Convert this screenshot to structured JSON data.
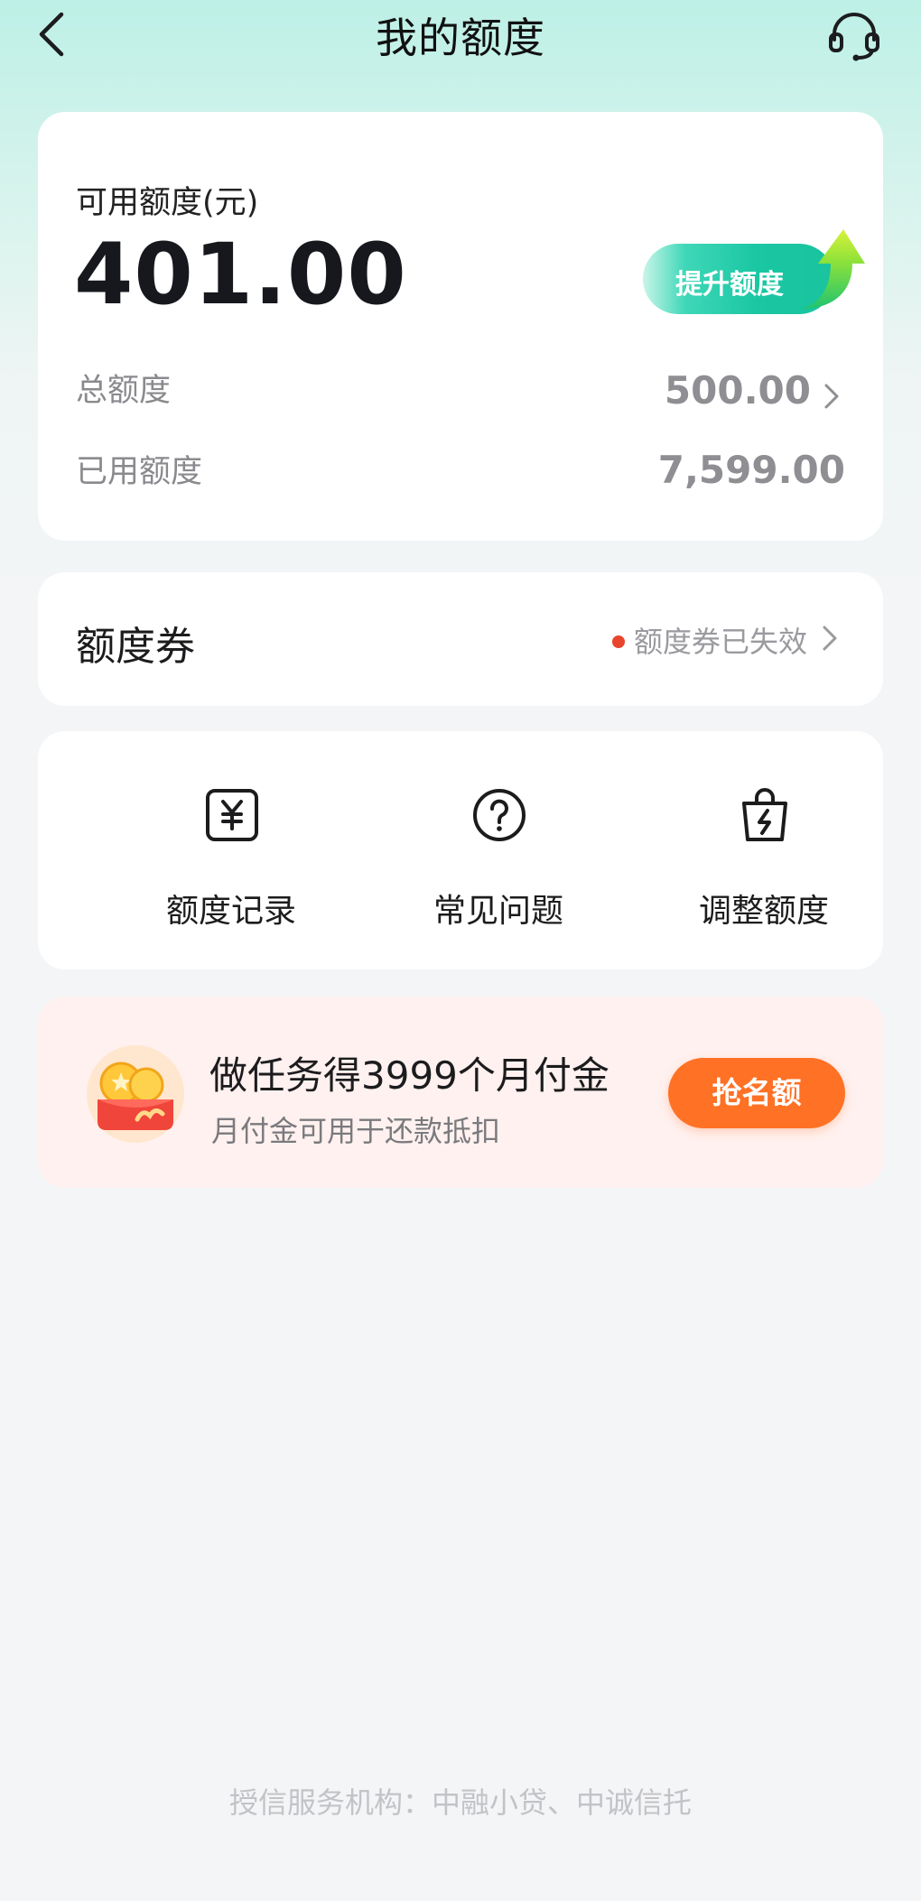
{
  "navbar": {
    "title": "我的额度"
  },
  "limit": {
    "available_label": "可用额度(元)",
    "available_value": "401.00",
    "raise_button": "提升额度",
    "total_label": "总额度",
    "total_value": "500.00",
    "used_label": "已用额度",
    "used_value": "7,599.00"
  },
  "coupon": {
    "title": "额度券",
    "status": "额度券已失效"
  },
  "menu": {
    "items": [
      {
        "label": "额度记录",
        "icon": "yuan-receipt-icon"
      },
      {
        "label": "常见问题",
        "icon": "question-circle-icon"
      },
      {
        "label": "调整额度",
        "icon": "lightning-bag-icon"
      }
    ]
  },
  "promo": {
    "title": "做任务得3999个月付金",
    "subtitle": "月付金可用于还款抵扣",
    "button": "抢名额",
    "icon": "coin-wallet-icon"
  },
  "footer": {
    "text": "授信服务机构：中融小贷、中诚信托"
  },
  "colors": {
    "accent_green": "#19c39e",
    "accent_orange": "#ff7125",
    "status_red": "#e8452c",
    "promo_bg": "#fff1ef"
  }
}
